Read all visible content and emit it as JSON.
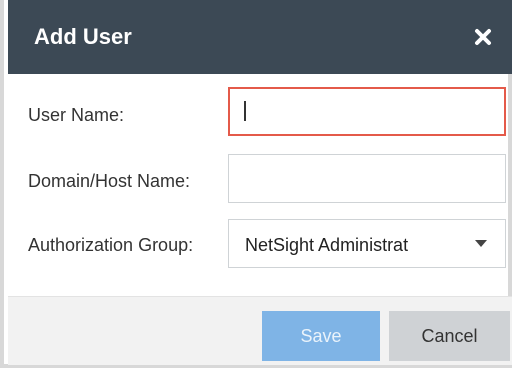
{
  "dialog": {
    "title": "Add User",
    "close_icon": "close-icon"
  },
  "form": {
    "user_name_label": "User Name:",
    "user_name_value": "",
    "domain_label": "Domain/Host Name:",
    "domain_value": "",
    "auth_group_label": "Authorization Group:",
    "auth_group_selected": "NetSight Administrat"
  },
  "buttons": {
    "save_label": "Save",
    "cancel_label": "Cancel"
  },
  "colors": {
    "titlebar": "#3c4955",
    "focus_border": "#e45a4a",
    "save_button": "#7fb4e6",
    "cancel_button": "#cfd2d5"
  }
}
